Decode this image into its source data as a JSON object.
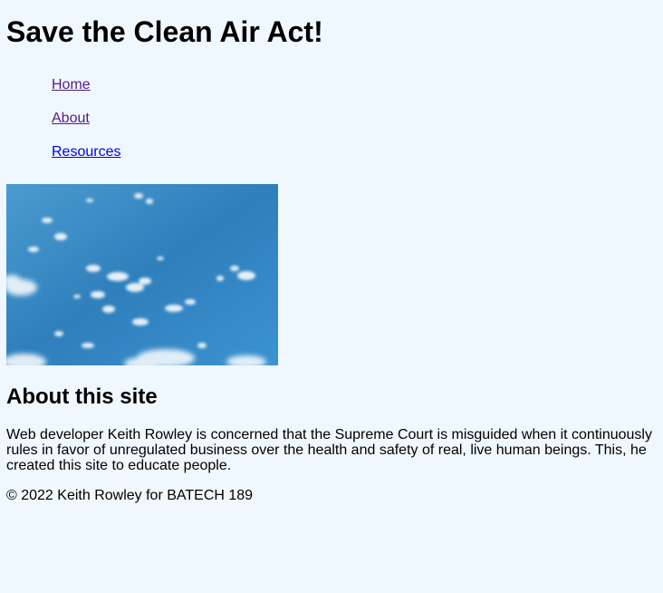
{
  "header": {
    "title": "Save the Clean Air Act!"
  },
  "nav": {
    "items": [
      {
        "label": "Home",
        "state": "visited"
      },
      {
        "label": "About",
        "state": "visited"
      },
      {
        "label": "Resources",
        "state": "unvisited"
      }
    ]
  },
  "hero": {
    "image": "sky-with-clouds"
  },
  "about": {
    "heading": "About this site",
    "text": "Web developer Keith Rowley is concerned that the Supreme Court is misguided when it continuously rules in favor of unregulated business over the health and safety of real, live human beings. This, he created this site to educate people."
  },
  "footer": {
    "text": "© 2022 Keith Rowley for BATECH 189"
  },
  "colors": {
    "background": "#f0f8ff",
    "link_visited": "#551a8b",
    "link_unvisited": "#0000ee",
    "sky": "#3a8cc6"
  }
}
